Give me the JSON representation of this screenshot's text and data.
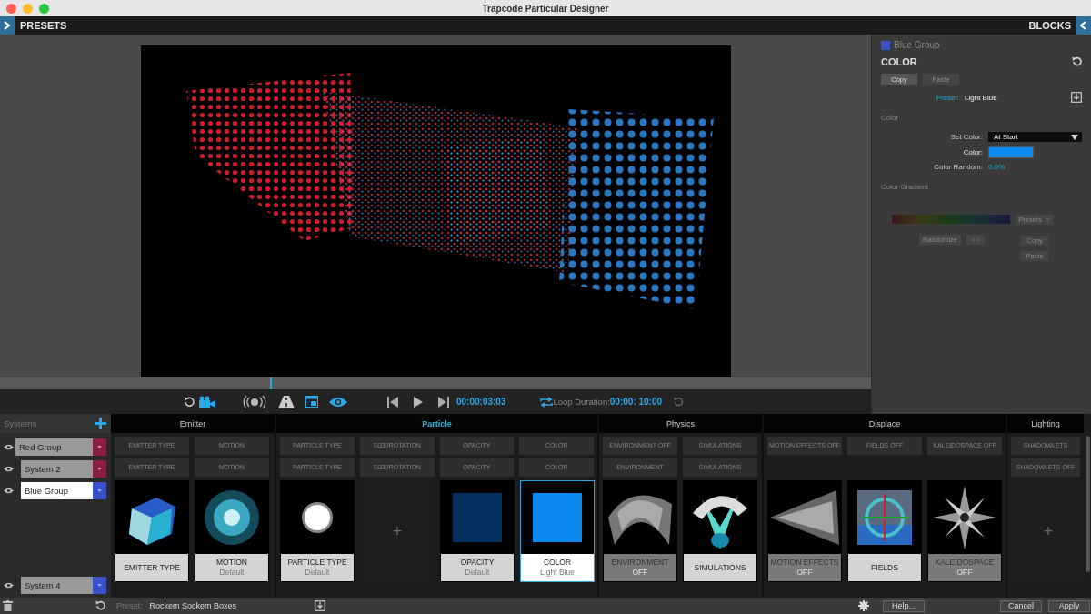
{
  "window": {
    "title": "Trapcode Particular Designer"
  },
  "header": {
    "left_label": "PRESETS",
    "right_label": "BLOCKS"
  },
  "timeline": {
    "level": 0.31
  },
  "transport": {
    "time": "00:00:03:03",
    "loop_label": "Loop Duration:",
    "loop_value": "00:00: 10:00",
    "preview_on": true
  },
  "inspector": {
    "group_name": "Blue Group",
    "group": {
      "color": "#3c52c8"
    },
    "title": "COLOR",
    "copy": "Copy",
    "paste": "Paste",
    "preset_label": "Preset:",
    "preset_value": "Light Blue",
    "section": "Color",
    "set_color_label": "Set Color:",
    "set_color_value": "At Start",
    "color_label": "Color:",
    "color_field": {
      "color": "#0a8af0"
    },
    "color_random_label": "Color Random:",
    "color_random_value": "0.0%",
    "gradient_section": "Color Gradient",
    "gradient_presets": "Presets",
    "randomize": "Randomize",
    "gradient_copy": "Copy",
    "gradient_paste": "Paste"
  },
  "systems": {
    "title": "Systems",
    "items": [
      {
        "name": "Red Group",
        "color": "#8a2040",
        "selected": false,
        "nested": false
      },
      {
        "name": "System 2",
        "color": "#8a2040",
        "selected": false,
        "nested": true
      },
      {
        "name": "Blue Group",
        "color": "#3c52c8",
        "selected": true,
        "nested": true
      },
      {
        "name": "System 4",
        "color": "#3c52c8",
        "selected": false,
        "nested": true
      }
    ]
  },
  "columns": [
    {
      "title": "Emitter",
      "selected": false,
      "ghost_rows": [
        [
          "EMITTER TYPE",
          "MOTION"
        ],
        [
          "EMITTER TYPE",
          "MOTION"
        ]
      ],
      "cards": [
        {
          "kind": "picture",
          "label": "EMITTER TYPE",
          "enabled": true,
          "selected": false
        },
        {
          "kind": "picture",
          "label": "MOTION",
          "sub": "Default",
          "enabled": true,
          "selected": false
        }
      ]
    },
    {
      "title": "Particle",
      "selected": true,
      "ghost_rows": [
        [
          "PARTICLE TYPE",
          "SIZE/ROTATION",
          "OPACITY",
          "COLOR"
        ],
        [
          "PARTICLE TYPE",
          "SIZE/ROTATION",
          "OPACITY",
          "COLOR"
        ]
      ],
      "cards": [
        {
          "kind": "picture",
          "label": "PARTICLE TYPE",
          "sub": "Default",
          "enabled": true,
          "selected": false
        },
        {
          "kind": "add",
          "label": "+"
        },
        {
          "kind": "swatch",
          "color": "#03305e",
          "label": "OPACITY",
          "sub": "Default",
          "enabled": true,
          "selected": false
        },
        {
          "kind": "swatch",
          "color": "#0a8af0",
          "label": "COLOR",
          "sub": "Light Blue",
          "enabled": true,
          "selected": true
        }
      ]
    },
    {
      "title": "Physics",
      "selected": false,
      "ghost_rows": [
        [
          "ENVIRONMENT OFF",
          "SIMULATIONS"
        ],
        [
          "ENVIRONMENT",
          "SIMULATIONS"
        ]
      ],
      "cards": [
        {
          "kind": "picture",
          "label": "ENVIRONMENT",
          "sub": "OFF",
          "enabled": false,
          "selected": false
        },
        {
          "kind": "picture",
          "label": "SIMULATIONS",
          "enabled": true,
          "selected": false
        }
      ]
    },
    {
      "title": "Displace",
      "selected": false,
      "ghost_rows": [
        [
          "MOTION EFFECTS OFF",
          "FIELDS OFF",
          "KALEIDOSPACE OFF"
        ]
      ],
      "cards": [
        {
          "kind": "picture",
          "label": "MOTION EFFECTS",
          "sub": "OFF",
          "enabled": false,
          "selected": false
        },
        {
          "kind": "picture",
          "label": "FIELDS",
          "enabled": true,
          "selected": false
        },
        {
          "kind": "picture",
          "label": "KALEIDOSPACE",
          "sub": "OFF",
          "enabled": false,
          "selected": false
        }
      ]
    },
    {
      "title": "Lighting",
      "selected": false,
      "ghost_rows": [
        [
          "SHADOWLETS"
        ],
        [
          "SHADOWLETS OFF"
        ]
      ],
      "cards": [
        {
          "kind": "add",
          "label": "+"
        }
      ]
    }
  ],
  "footer": {
    "preset_label": "Preset:",
    "preset_value": "Rockem Sockem Boxes",
    "help": "Help...",
    "cancel": "Cancel",
    "apply": "Apply"
  }
}
